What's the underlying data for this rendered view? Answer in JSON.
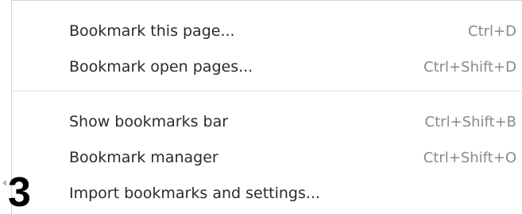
{
  "menu": {
    "group1": [
      {
        "label": "Bookmark this page...",
        "shortcut": "Ctrl+D"
      },
      {
        "label": "Bookmark open pages...",
        "shortcut": "Ctrl+Shift+D"
      }
    ],
    "group2": [
      {
        "label": "Show bookmarks bar",
        "shortcut": "Ctrl+Shift+B"
      },
      {
        "label": "Bookmark manager",
        "shortcut": "Ctrl+Shift+O"
      },
      {
        "label": "Import bookmarks and settings...",
        "shortcut": ""
      }
    ]
  },
  "annotation": {
    "step_number": "3"
  }
}
